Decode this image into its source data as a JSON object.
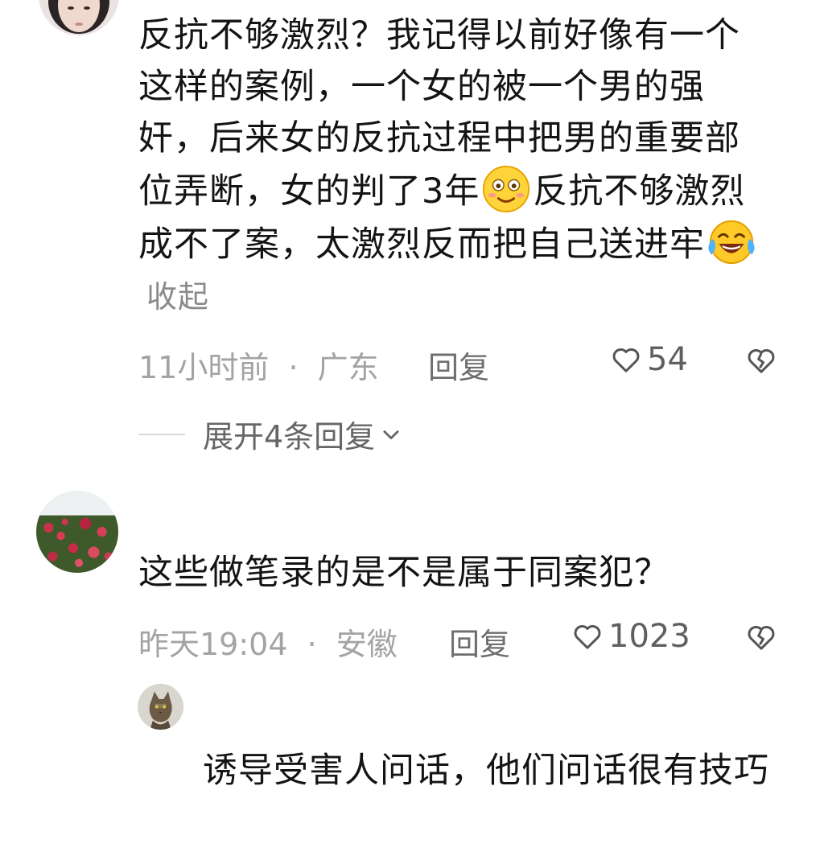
{
  "comments": [
    {
      "avatar_icon": "avatar-girl-icon",
      "text_before_emoji1": "反抗不够激烈？我记得以前好像有一个这样的案例，一个女的被一个男的强奸，后来女的反抗过程中把男的重要部位弄断，女的判了3年",
      "emoji1": "smiling-face-emoji-icon",
      "text_between_emojis": "反抗不够激烈成不了案，太激烈反而把自己送进牢",
      "emoji2": "laughing-crying-emoji-icon",
      "collapse_label": "收起",
      "time": "11小时前",
      "dot": "·",
      "location": "广东",
      "reply_label": "回复",
      "like_count": "54",
      "expand_label": "展开4条回复"
    },
    {
      "avatar_icon": "avatar-roses-photo-icon",
      "text": "这些做笔录的是不是属于同案犯？",
      "time": "昨天19:04",
      "dot": "·",
      "location": "安徽",
      "reply_label": "回复",
      "like_count": "1023",
      "reply": {
        "avatar_icon": "avatar-cat-photo-icon",
        "text": "诱导受害人问话，他们问话很有技巧"
      }
    }
  ],
  "colors": {
    "text": "#141414",
    "meta": "#a3a3a3",
    "secondary": "#666666"
  }
}
